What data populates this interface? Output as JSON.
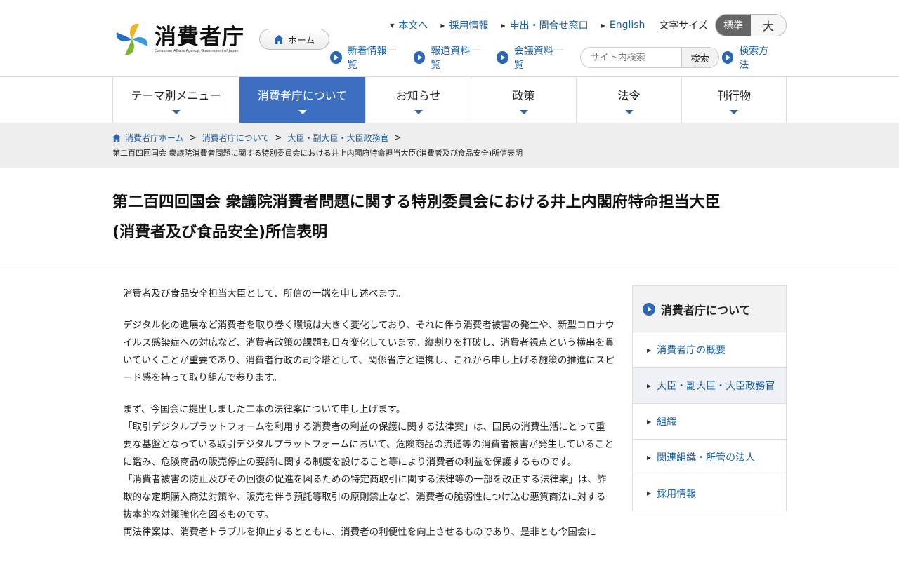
{
  "header": {
    "logo_ja": "消費者庁",
    "logo_en": "Consumer Affairs Agency, Government of Japan",
    "home_label": "ホーム",
    "util_links": [
      "本文へ",
      "採用情報",
      "申出・問合せ窓口",
      "English"
    ],
    "font_size_label": "文字サイズ",
    "font_size_standard": "標準",
    "font_size_large": "大",
    "sub_links": [
      "新着情報一覧",
      "報道資料一覧",
      "会議資料一覧"
    ],
    "search_placeholder": "サイト内検索",
    "search_button": "検索",
    "search_help": "検索方法"
  },
  "gnav": [
    "テーマ別メニュー",
    "消費者庁について",
    "お知らせ",
    "政策",
    "法令",
    "刊行物"
  ],
  "breadcrumb": {
    "items": [
      "消費者庁ホーム",
      "消費者庁について",
      "大臣・副大臣・大臣政務官"
    ],
    "current": "第二百四回国会 衆議院消費者問題に関する特別委員会における井上内閣府特命担当大臣(消費者及び食品安全)所信表明"
  },
  "page_title_line1": "第二百四回国会 衆議院消費者問題に関する特別委員会における井上内閣府特命担当大臣",
  "page_title_line2": "(消費者及び食品安全)所信表明",
  "content": {
    "p1": "消費者及び食品安全担当大臣として、所信の一端を申し述べます。",
    "p2": "デジタル化の進展など消費者を取り巻く環境は大きく変化しており、それに伴う消費者被害の発生や、新型コロナウイルス感染症への対応など、消費者政策の課題も日々変化しています。縦割りを打破し、消費者視点という横串を貫いていくことが重要であり、消費者行政の司令塔として、関係省庁と連携し、これから申し上げる施策の推進にスピード感を持って取り組んで参ります。",
    "p3": "まず、今国会に提出しました二本の法律案について申し上げます。",
    "p4": "「取引デジタルプラットフォームを利用する消費者の利益の保護に関する法律案」は、国民の消費生活にとって重要な基盤となっている取引デジタルプラットフォームにおいて、危険商品の流通等の消費者被害が発生していることに鑑み、危険商品の販売停止の要請に関する制度を設けること等により消費者の利益を保護するものです。",
    "p5": "「消費者被害の防止及びその回復の促進を図るための特定商取引に関する法律等の一部を改正する法律案」は、詐欺的な定期購入商法対策や、販売を伴う預託等取引の原則禁止など、消費者の脆弱性につけ込む悪質商法に対する抜本的な対策強化を図るものです。",
    "p6": "両法律案は、消費者トラブルを抑止するとともに、消費者の利便性を向上させるものであり、是非とも今国会に"
  },
  "side": {
    "heading": "消費者庁について",
    "items": [
      "消費者庁の概要",
      "大臣・副大臣・大臣政務官",
      "組織",
      "関連組織・所管の法人",
      "採用情報"
    ]
  },
  "colors": {
    "accent": "#3c6fbf",
    "link": "#1a5fa8"
  }
}
